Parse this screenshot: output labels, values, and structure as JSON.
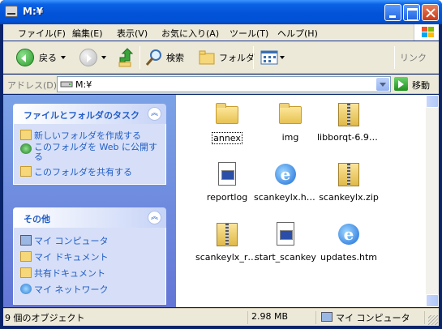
{
  "window": {
    "title": "M:¥"
  },
  "menu": [
    "ファイル(F)",
    "編集(E)",
    "表示(V)",
    "お気に入り(A)",
    "ツール(T)",
    "ヘルプ(H)"
  ],
  "toolbar": {
    "back_label": "戻る",
    "search_label": "検索",
    "folders_label": "フォルダ",
    "links_label": "リンク"
  },
  "address": {
    "label": "アドレス(D)",
    "value": "M:¥",
    "go_label": "移動"
  },
  "tasks": {
    "title": "ファイルとフォルダのタスク",
    "items": [
      "新しいフォルダを作成する",
      "このフォルダを Web に公開する",
      "このフォルダを共有する"
    ]
  },
  "other": {
    "title": "その他",
    "items": [
      "マイ コンピュータ",
      "マイ ドキュメント",
      "共有ドキュメント",
      "マイ ネットワーク"
    ]
  },
  "files": [
    {
      "name": "annex",
      "icon": "folder-icon"
    },
    {
      "name": "img",
      "icon": "folder-icon"
    },
    {
      "name": "libborqt-6.9-...",
      "icon": "zip-icon"
    },
    {
      "name": "reportlog",
      "icon": "text-document-icon"
    },
    {
      "name": "scankeylx.htm",
      "icon": "ie-document-icon"
    },
    {
      "name": "scankeylx.zip",
      "icon": "zip-icon"
    },
    {
      "name": "scankeylx_r0...",
      "icon": "zip-icon"
    },
    {
      "name": "start_scankey",
      "icon": "text-document-icon"
    },
    {
      "name": "updates.htm",
      "icon": "ie-document-icon"
    }
  ],
  "status": {
    "count": "9 個のオブジェクト",
    "size": "2.98 MB",
    "location": "マイ コンピュータ"
  }
}
